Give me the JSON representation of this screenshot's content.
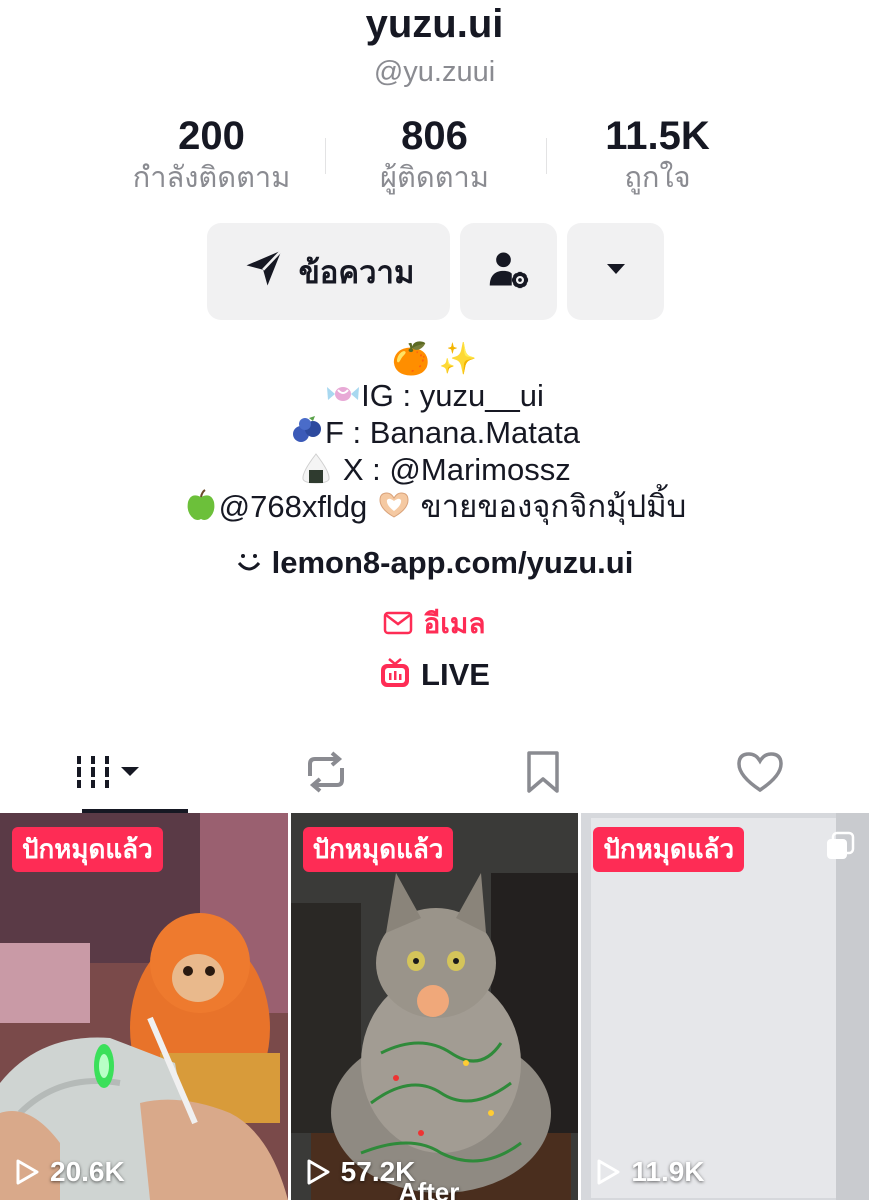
{
  "profile": {
    "username": "yuzu.ui",
    "handle": "@yu.zuui"
  },
  "stats": [
    {
      "value": "200",
      "label": "กำลังติดตาม"
    },
    {
      "value": "806",
      "label": "ผู้ติดตาม"
    },
    {
      "value": "11.5K",
      "label": "ถูกใจ"
    }
  ],
  "actions": {
    "message_label": "ข้อความ",
    "message_icon": "send-icon",
    "user_settings_icon": "user-gear-icon",
    "more_icon": "caret-down-icon"
  },
  "bio": {
    "line1": "🍊 ✨",
    "line2_text": "IG : yuzu__ui",
    "line3_text": "F : Banana.Matata",
    "line4_text": " X : @Marimossz",
    "line5_text": "@768xfldg",
    "line5_text2": " ขายของจุกจิกมุ้ปมิ้บ"
  },
  "link": {
    "text": "lemon8-app.com/yuzu.ui",
    "icon": "smile-link-icon"
  },
  "email": {
    "label": "อีเมล",
    "icon": "mail-icon"
  },
  "live": {
    "label": "LIVE",
    "icon": "tv-live-icon"
  },
  "tabs": [
    {
      "name": "videos",
      "icon": "grid-bars-icon",
      "active": true
    },
    {
      "name": "reposts",
      "icon": "repost-icon",
      "active": false
    },
    {
      "name": "favorites",
      "icon": "bookmark-icon",
      "active": false
    },
    {
      "name": "liked",
      "icon": "heart-icon",
      "active": false
    }
  ],
  "videos": [
    {
      "badge": "ปักหมุดแล้ว",
      "views": "20.6K"
    },
    {
      "badge": "ปักหมุดแล้ว",
      "views": "57.2K",
      "overlay_text": "After"
    },
    {
      "badge": "ปักหมุดแล้ว",
      "views": "11.9K"
    }
  ],
  "colors": {
    "accent": "#fe2c55",
    "text": "#161823",
    "muted": "#8a8b91",
    "button_bg": "#f1f1f2"
  }
}
